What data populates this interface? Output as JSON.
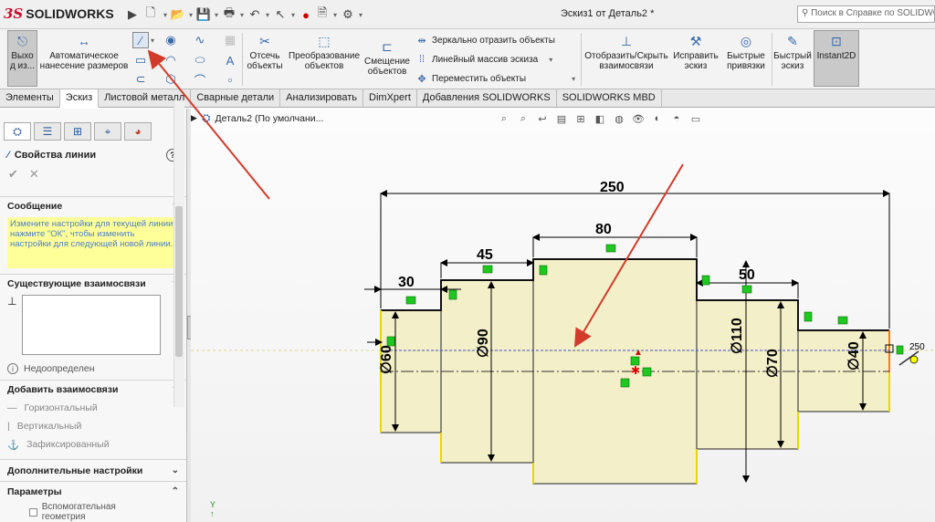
{
  "app": {
    "logo_ds": "3S",
    "logo_name": "SOLIDWORKS",
    "title": "Эскиз1 от Деталь2 *",
    "search_placeholder": "Поиск в Справке по SOLIDWORKS"
  },
  "ribbon": {
    "exit": "Выхо\nд из...",
    "smart_dim": "Автоматическое\nнанесение размеров",
    "trim": "Отсечь\nобъекты",
    "convert": "Преобразование\nобъектов",
    "offset": "Смещение\nобъектов",
    "mirror": "Зеркально отразить объекты",
    "linear_pattern": "Линейный массив эскиза",
    "move": "Переместить объекты",
    "show_hide": "Отобразить/Скрыть\nвзаимосвязи",
    "repair": "Исправить\nэскиз",
    "quick_snaps": "Быстрые\nпривязки",
    "rapid_sketch": "Быстрый\nэскиз",
    "instant2d": "Instant2D"
  },
  "tabs": [
    "Элементы",
    "Эскиз",
    "Листовой металл",
    "Сварные детали",
    "Анализировать",
    "DimXpert",
    "Добавления SOLIDWORKS",
    "SOLIDWORKS MBD"
  ],
  "active_tab": "Эскиз",
  "panel": {
    "title": "Свойства линии",
    "help": "?",
    "ok": "✔",
    "cancel": "✕",
    "message_head": "Сообщение",
    "message": "Измените настройки для текущей линии, нажмите \"ОК\", чтобы изменить настройки для следующей новой линии.",
    "existing_head": "Существующие взаимосвязи",
    "status": "Недоопределен",
    "add_head": "Добавить взаимосвязи",
    "add_items": [
      "Горизонтальный",
      "Вертикальный",
      "Зафиксированный"
    ],
    "extra_head": "Дополнительные настройки",
    "params_head": "Параметры",
    "construction": "Вспомогательная геометрия"
  },
  "tree": {
    "label": "Деталь2  (По умолчани..."
  },
  "drawing": {
    "overall": "250",
    "d30": "30",
    "d45": "45",
    "d80": "80",
    "d50": "50",
    "dia60": "∅60",
    "dia90": "∅90",
    "dia110": "∅110",
    "dia70": "∅70",
    "dia40": "∅40",
    "cursor_len": "250"
  },
  "colors": {
    "accent": "#3a6aa8",
    "arrow": "#d23b2a",
    "shaft_fill": "#f3efc8",
    "relation_green": "#1fc81f"
  }
}
